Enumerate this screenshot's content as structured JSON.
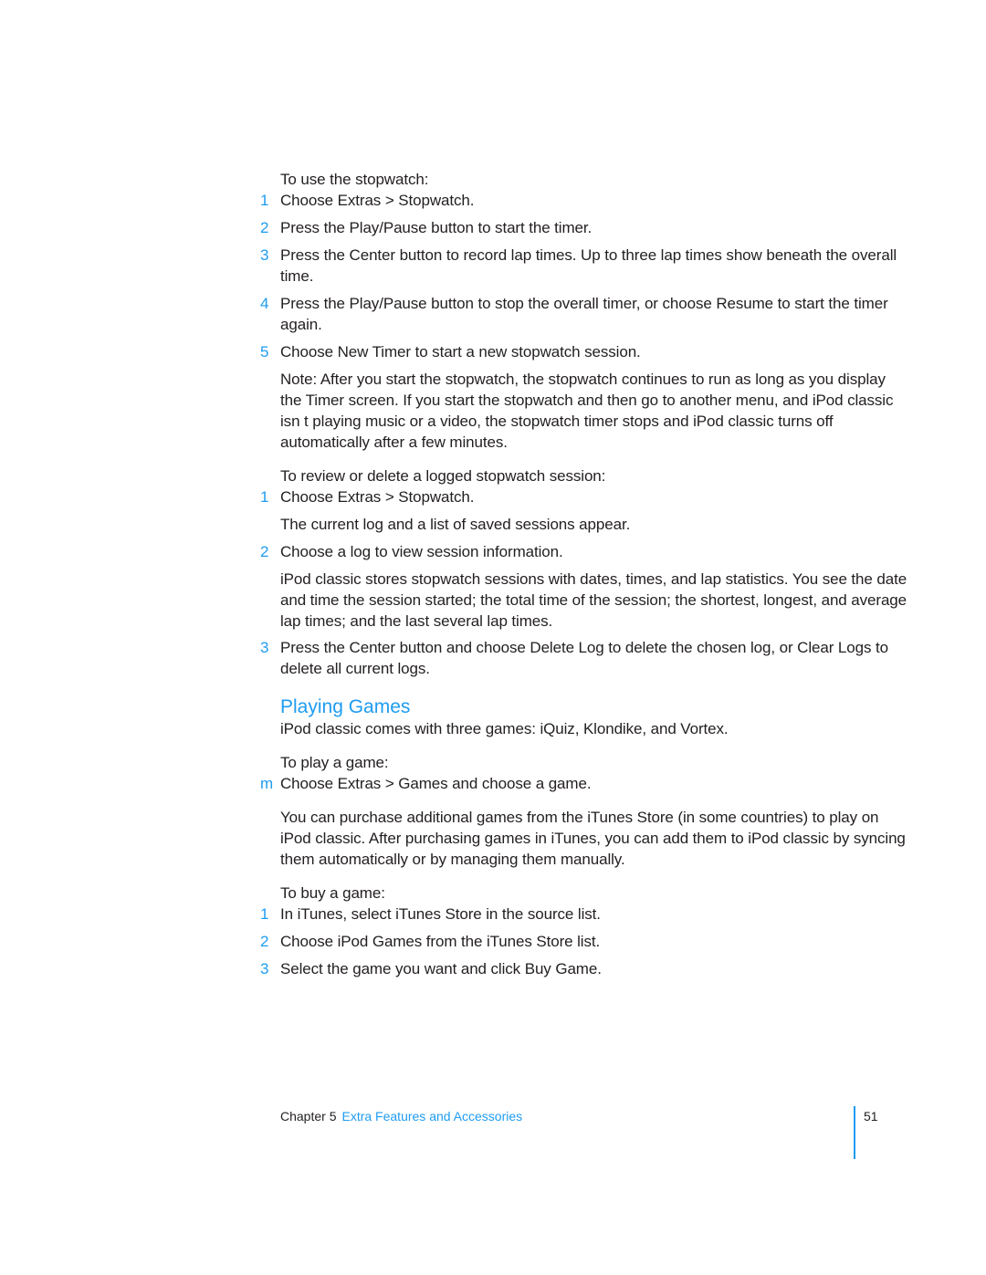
{
  "colors": {
    "accent": "#1e9cf0",
    "text": "#231f20"
  },
  "stopwatch_use": {
    "intro": "To use the stopwatch:",
    "steps": [
      {
        "num": "1",
        "text": "Choose Extras > Stopwatch."
      },
      {
        "num": "2",
        "text": "Press the Play/Pause button to start the timer."
      },
      {
        "num": "3",
        "text": "Press the Center button to record lap times. Up to three lap times show beneath the overall time."
      },
      {
        "num": "4",
        "text": "Press the Play/Pause button to stop the overall timer, or choose Resume to start the timer again."
      },
      {
        "num": "5",
        "text": "Choose New Timer to start a new stopwatch session."
      }
    ],
    "note": "Note: After you start the stopwatch, the stopwatch continues to run as long as you display the Timer screen. If you start the stopwatch and then go to another menu, and iPod classic isn t playing music or a video, the stopwatch timer stops and iPod classic turns off automatically after a few minutes."
  },
  "stopwatch_review": {
    "intro": "To review or delete a logged stopwatch session:",
    "steps": [
      {
        "num": "1",
        "text": "Choose Extras > Stopwatch.",
        "detail": "The current log and a list of saved sessions appear."
      },
      {
        "num": "2",
        "text": "Choose a log to view session information.",
        "detail": "iPod classic stores stopwatch sessions with dates, times, and lap statistics. You see the date and time the session started; the total time of the session; the shortest, longest, and average lap times; and the last several lap times."
      },
      {
        "num": "3",
        "text": "Press the Center button and choose Delete Log to delete the chosen log, or Clear Logs to delete all current logs."
      }
    ]
  },
  "games": {
    "heading": "Playing Games",
    "intro": "iPod classic comes with three games: iQuiz, Klondike, and Vortex.",
    "play_intro": "To play a game:",
    "play_step": {
      "num": "m",
      "text": "Choose Extras > Games and choose a game."
    },
    "purchase_text": "You can purchase additional games from the iTunes Store (in some countries) to play on iPod classic. After purchasing games in iTunes, you can add them to iPod classic by syncing them automatically or by managing them manually.",
    "buy_intro": "To buy a game:",
    "buy_steps": [
      {
        "num": "1",
        "text": "In iTunes, select iTunes Store in the source list."
      },
      {
        "num": "2",
        "text": "Choose iPod Games from the iTunes Store list."
      },
      {
        "num": "3",
        "text": "Select the game you want and click Buy Game."
      }
    ]
  },
  "footer": {
    "chapter_label": "Chapter 5",
    "chapter_title": "Extra Features and Accessories",
    "page_number": "51"
  }
}
